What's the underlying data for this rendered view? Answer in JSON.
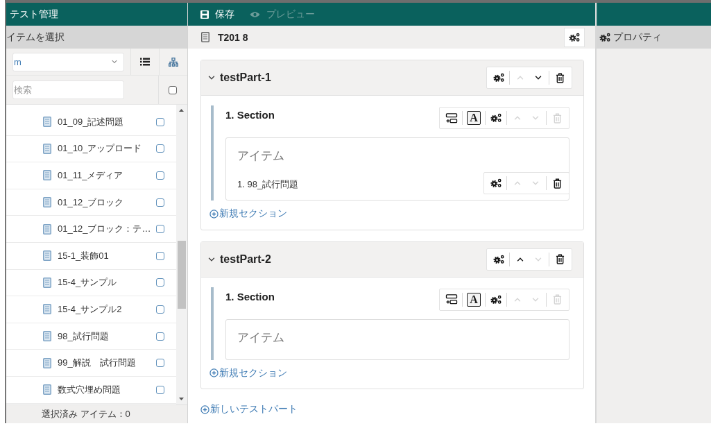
{
  "app": {
    "title": "テスト管理"
  },
  "toolbar": [
    {
      "kind": "save",
      "label": "保存",
      "disabled": false
    },
    {
      "kind": "preview",
      "label": "プレビュー",
      "disabled": true
    }
  ],
  "item_picker": {
    "title": "イテムを選択",
    "filter": {
      "value": "m"
    },
    "search": {
      "placeholder": "検索"
    },
    "select_all": {
      "checked": false
    },
    "items": [
      {
        "label": "01_09_記述問題",
        "checked": false
      },
      {
        "label": "01_10_アップロード",
        "checked": false
      },
      {
        "label": "01_11_メディア",
        "checked": false
      },
      {
        "label": "01_12_ブロック",
        "checked": false
      },
      {
        "label": "01_12_ブロック：テ…",
        "checked": false
      },
      {
        "label": "15-1_装飾01",
        "checked": false
      },
      {
        "label": "15-4_サンプル",
        "checked": false
      },
      {
        "label": "15-4_サンプル2",
        "checked": false
      },
      {
        "label": "98_試行問題",
        "checked": false
      },
      {
        "label": "99_解説　試行問題",
        "checked": false
      },
      {
        "label": "数式穴埋め問題",
        "checked": false
      }
    ],
    "selected_count": "選択済み アイテム：0"
  },
  "test": {
    "title": "T201 8",
    "parts": [
      {
        "title": "testPart-1",
        "expanded": true,
        "tools": [
          {
            "kind": "gear",
            "disabled": false
          },
          {
            "kind": "up",
            "disabled": true
          },
          {
            "kind": "down",
            "disabled": false
          },
          {
            "kind": "delete",
            "disabled": false
          }
        ],
        "sections": [
          {
            "title": "1. Section",
            "tools": [
              {
                "kind": "add-row",
                "disabled": false
              },
              {
                "kind": "text",
                "label": "A",
                "disabled": false
              },
              {
                "kind": "gear",
                "disabled": false
              },
              {
                "kind": "up",
                "disabled": true
              },
              {
                "kind": "down",
                "disabled": true
              },
              {
                "kind": "delete",
                "disabled": true
              }
            ],
            "items_heading": "アイテム",
            "items": [
              {
                "label": "1. 98_試行問題",
                "tools": [
                  {
                    "kind": "gear",
                    "disabled": false
                  },
                  {
                    "kind": "up",
                    "disabled": true
                  },
                  {
                    "kind": "down",
                    "disabled": true
                  },
                  {
                    "kind": "delete",
                    "disabled": false
                  }
                ]
              }
            ]
          }
        ],
        "add_section": "新規セクション"
      },
      {
        "title": "testPart-2",
        "expanded": true,
        "tools": [
          {
            "kind": "gear",
            "disabled": false
          },
          {
            "kind": "up",
            "disabled": false
          },
          {
            "kind": "down",
            "disabled": true
          },
          {
            "kind": "delete",
            "disabled": false
          }
        ],
        "sections": [
          {
            "title": "1. Section",
            "tools": [
              {
                "kind": "add-row",
                "disabled": false
              },
              {
                "kind": "text",
                "label": "A",
                "disabled": false
              },
              {
                "kind": "gear",
                "disabled": false
              },
              {
                "kind": "up",
                "disabled": true
              },
              {
                "kind": "down",
                "disabled": true
              },
              {
                "kind": "delete",
                "disabled": true
              }
            ],
            "items_heading": "アイテム"
          }
        ],
        "add_section": "新規セクション"
      }
    ],
    "add_part": "新しいテストパート"
  },
  "properties": {
    "title": "プロパティ"
  }
}
